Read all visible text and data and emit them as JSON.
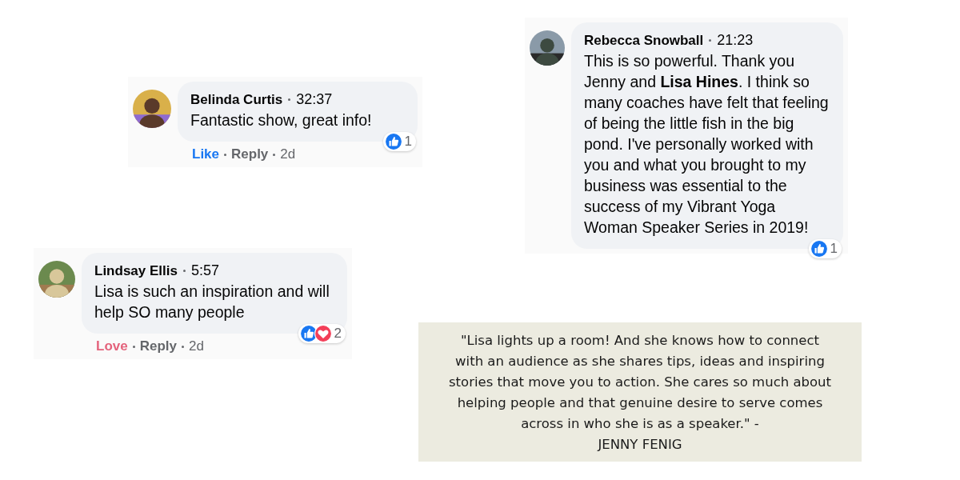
{
  "comments": [
    {
      "author": "Belinda Curtis",
      "time": "32:37",
      "text": "Fantastic show, great info!",
      "action": {
        "label": "Like",
        "kind": "like"
      },
      "reply": "Reply",
      "age": "2d",
      "reactions": [
        {
          "kind": "like"
        }
      ],
      "reaction_count": "1"
    },
    {
      "author": "Lindsay Ellis",
      "time": "5:57",
      "text": "Lisa is such an inspiration and will help SO many people",
      "action": {
        "label": "Love",
        "kind": "love"
      },
      "reply": "Reply",
      "age": "2d",
      "reactions": [
        {
          "kind": "like"
        },
        {
          "kind": "love"
        }
      ],
      "reaction_count": "2"
    },
    {
      "author": "Rebecca Snowball",
      "time": "21:23",
      "text": "This is so powerful. Thank you Jenny and **Lisa Hines**. I think so many coaches have felt that feeling of being the little fish in the big pond. I've personally worked with you and what you brought to my business was essential to the success of my Vibrant Yoga Woman Speaker Series in 2019!",
      "reactions": [
        {
          "kind": "like"
        }
      ],
      "reaction_count": "1"
    }
  ],
  "quote": {
    "text": "\"Lisa lights up a room! And she knows how to connect with an audience as she shares tips, ideas and inspiring stories that move you to action. She cares so much about helping people and that genuine desire to serve comes across in who she is as a speaker.\" -",
    "attribution": "JENNY FENIG"
  }
}
